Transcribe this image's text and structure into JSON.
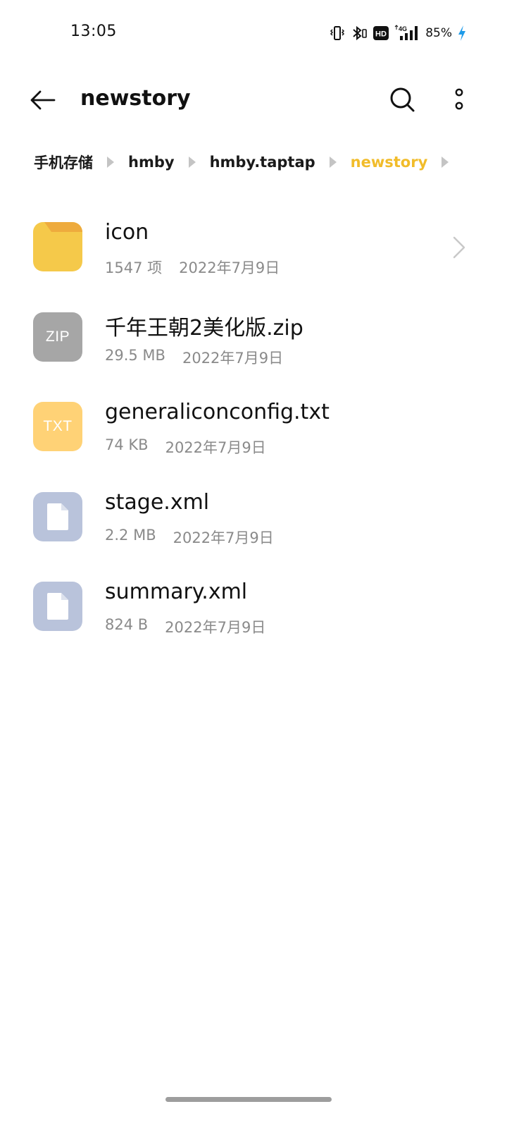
{
  "status_bar": {
    "time": "13:05",
    "battery": "85%",
    "icons": [
      "vibrate-icon",
      "bluetooth-icon",
      "hd-icon",
      "4g-signal-icon",
      "battery-charging-icon"
    ],
    "network_label": "4G",
    "hd_label": "HD"
  },
  "app_bar": {
    "title": "newstory"
  },
  "breadcrumb": [
    {
      "label": "手机存储"
    },
    {
      "label": "hmby"
    },
    {
      "label": "hmby.taptap"
    },
    {
      "label": "newstory"
    }
  ],
  "colors": {
    "accent": "#f1bc2a",
    "folder": "#f5c94a",
    "zip": "#a6a6a6",
    "txt": "#ffd276",
    "generic_file": "#b9c3db"
  },
  "files": [
    {
      "name": "icon",
      "size": "1547 项",
      "date": "2022年7月9日",
      "type": "folder"
    },
    {
      "name": "千年王朝2美化版.zip",
      "size": "29.5 MB",
      "date": "2022年7月9日",
      "type": "zip",
      "badge": "ZIP"
    },
    {
      "name": "generaliconconfig.txt",
      "size": "74 KB",
      "date": "2022年7月9日",
      "type": "txt",
      "badge": "TXT"
    },
    {
      "name": "stage.xml",
      "size": "2.2 MB",
      "date": "2022年7月9日",
      "type": "file"
    },
    {
      "name": "summary.xml",
      "size": "824 B",
      "date": "2022年7月9日",
      "type": "file"
    }
  ]
}
